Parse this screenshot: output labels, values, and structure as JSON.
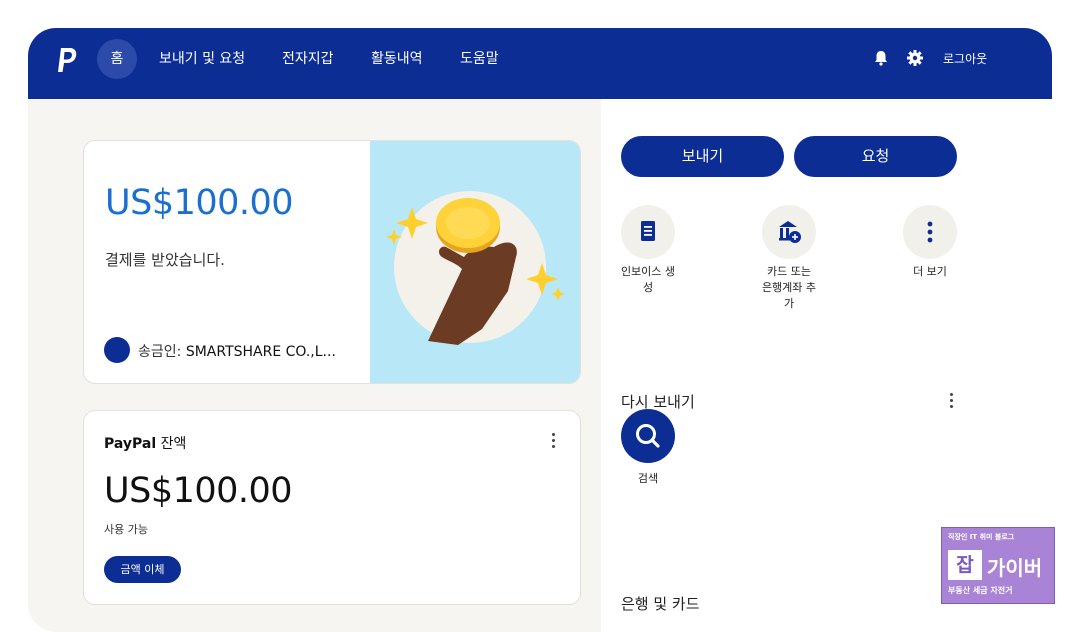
{
  "nav": {
    "home": "홈",
    "send_request": "보내기 및 요청",
    "wallet": "전자지갑",
    "activity": "활동내역",
    "help": "도움말",
    "logout": "로그아웃",
    "icons": [
      "paypal-logo",
      "bell-icon",
      "gear-icon"
    ]
  },
  "payment_card": {
    "amount": "US$100.00",
    "message": "결제를 받았습니다.",
    "sender_label": "송금인: ",
    "sender_name": "SMARTSHARE CO.,L..."
  },
  "balance_card": {
    "brand": "PayPal",
    "title": " 잔액",
    "amount": "US$100.00",
    "available": "사용 가능",
    "transfer_button": "금액 이체"
  },
  "actions": {
    "send_button": "보내기",
    "request_button": "요청",
    "items": [
      {
        "label": "인보이스 생\n성",
        "icon": "invoice-icon"
      },
      {
        "label": "카드 또는\n은행계좌 추\n가",
        "icon": "bank-add-icon"
      },
      {
        "label": "더 보기",
        "icon": "more-icon"
      }
    ]
  },
  "send_again": {
    "title": "다시 보내기",
    "search_label": "검색"
  },
  "banks_cards": {
    "title": "은행 및 카드"
  },
  "watermark": {
    "top": "직장인 IT 취미 블로그",
    "box1": "잡",
    "mid": "가이버",
    "bottom": "부동산 세금 자전거"
  },
  "colors": {
    "brand_navy": "#0c2d94",
    "amount_blue": "#1b6fd0",
    "illustration_bg": "#b8e8f8",
    "left_bg": "#f6f5f1"
  }
}
